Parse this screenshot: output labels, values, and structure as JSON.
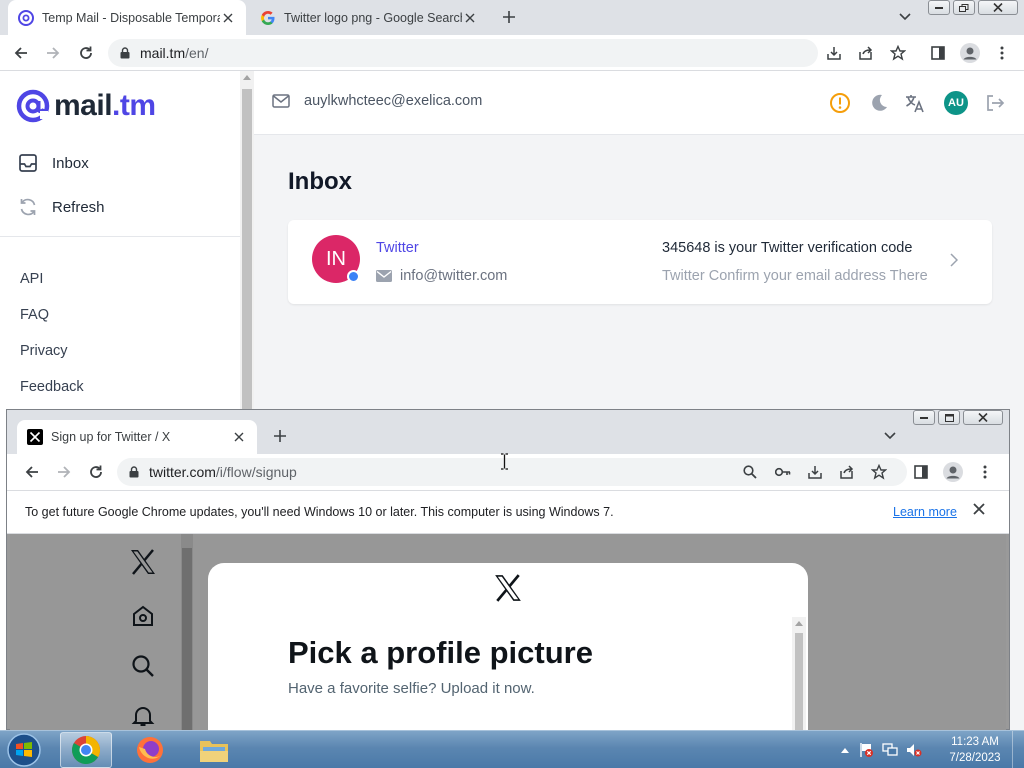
{
  "back_window": {
    "tabs": [
      {
        "title": "Temp Mail - Disposable Temporary Email"
      },
      {
        "title": "Twitter logo png - Google Search"
      }
    ],
    "url": {
      "host": "mail.tm",
      "path": "/en/"
    }
  },
  "mailtm": {
    "logo": {
      "name": "mail",
      "tld": ".tm"
    },
    "sidebar": {
      "inbox_label": "Inbox",
      "refresh_label": "Refresh",
      "links": [
        "API",
        "FAQ",
        "Privacy",
        "Feedback"
      ]
    },
    "header": {
      "email": "auylkwhcteec@exelica.com",
      "avatar_initials": "AU"
    },
    "inbox_title": "Inbox",
    "messages": [
      {
        "avatar": "IN",
        "sender": "Twitter",
        "from": "info@twitter.com",
        "subject": "345648 is your Twitter verification code",
        "preview": "Twitter Confirm your email address There"
      }
    ]
  },
  "front_window": {
    "tab_title": "Sign up for Twitter / X",
    "url": {
      "host": "twitter.com",
      "path": "/i/flow/signup"
    },
    "infobar": {
      "message": "To get future Google Chrome updates, you'll need Windows 10 or later. This computer is using Windows 7.",
      "link": "Learn more"
    },
    "modal": {
      "title": "Pick a profile picture",
      "subtitle": "Have a favorite selfie? Upload it now."
    }
  },
  "taskbar": {
    "time": "11:23 AM",
    "date": "7/28/2023"
  },
  "colors": {
    "mailtm_accent": "#4f46e5",
    "avatar_in": "#db2767",
    "avatar_au": "#0d9488",
    "warning": "#f59e0b",
    "link_blue": "#1a73e8"
  }
}
